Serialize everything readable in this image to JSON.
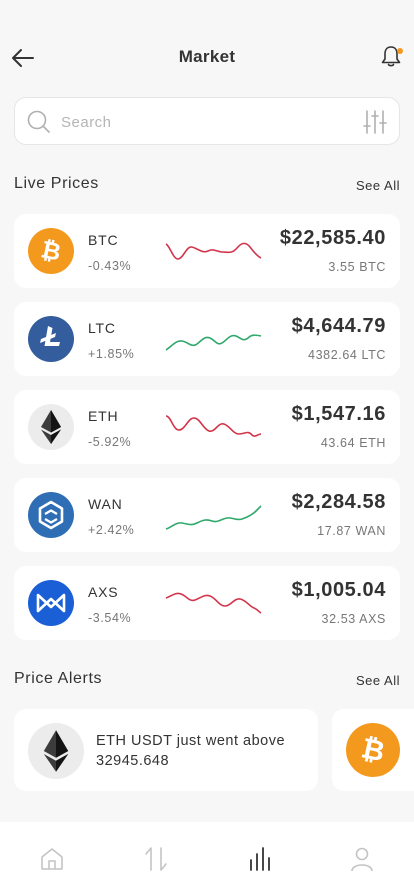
{
  "header": {
    "title": "Market",
    "back_icon": "arrow-left-icon",
    "notification_icon": "bell-icon",
    "notification_dot_color": "#f39a1e"
  },
  "search": {
    "placeholder": "Search",
    "value": "",
    "search_icon": "search-icon",
    "filter_icon": "sliders-icon"
  },
  "live_prices": {
    "title": "Live Prices",
    "see_all": "See All",
    "coins": [
      {
        "symbol": "BTC",
        "change": "-0.43%",
        "price": "$22,585.40",
        "holding": "3.55 BTC",
        "trend": "down",
        "logo_color": "#f39a1e",
        "icon": "bitcoin-icon"
      },
      {
        "symbol": "LTC",
        "change": "+1.85%",
        "price": "$4,644.79",
        "holding": "4382.64 LTC",
        "trend": "up",
        "logo_color": "#345d9d",
        "icon": "litecoin-icon"
      },
      {
        "symbol": "ETH",
        "change": "-5.92%",
        "price": "$1,547.16",
        "holding": "43.64 ETH",
        "trend": "down",
        "logo_color": "#ececec",
        "icon": "ethereum-icon"
      },
      {
        "symbol": "WAN",
        "change": "+2.42%",
        "price": "$2,284.58",
        "holding": "17.87 WAN",
        "trend": "up",
        "logo_color": "#2f6eb5",
        "icon": "wanchain-icon"
      },
      {
        "symbol": "AXS",
        "change": "-3.54%",
        "price": "$1,005.04",
        "holding": "32.53 AXS",
        "trend": "down",
        "logo_color": "#1b5fd6",
        "icon": "axie-icon"
      }
    ],
    "colors": {
      "up": "#2fa86b",
      "down": "#d2344a"
    }
  },
  "price_alerts": {
    "title": "Price Alerts",
    "see_all": "See All",
    "alerts": [
      {
        "text": "ETH USDT just went above 32945.648",
        "icon": "ethereum-icon"
      },
      {
        "text": "",
        "icon": "bitcoin-icon"
      }
    ]
  },
  "bottom_nav": {
    "items": [
      {
        "name": "home",
        "icon": "home-icon"
      },
      {
        "name": "trade",
        "icon": "swap-arrows-icon"
      },
      {
        "name": "market",
        "icon": "bar-chart-icon",
        "active": true
      },
      {
        "name": "profile",
        "icon": "user-icon"
      }
    ]
  }
}
